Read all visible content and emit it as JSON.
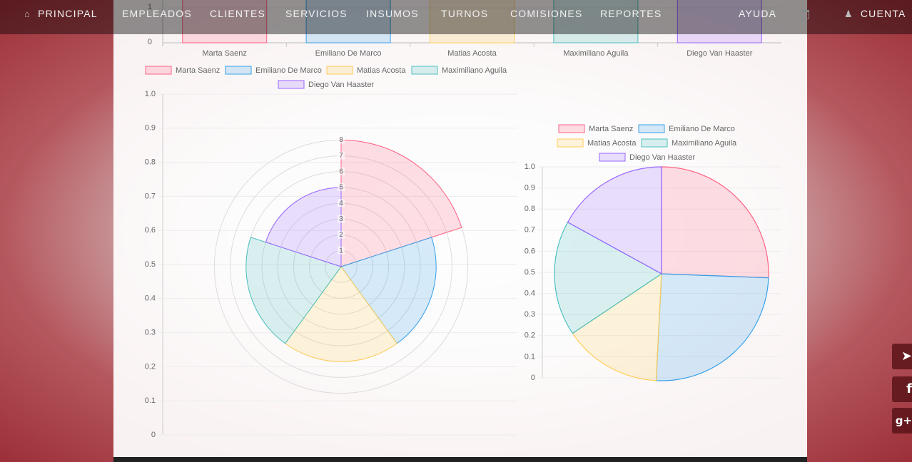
{
  "nav": {
    "items": [
      {
        "label": "PRINCIPAL",
        "icon": "home-icon"
      },
      {
        "label": "EMPLEADOS"
      },
      {
        "label": "CLIENTES"
      },
      {
        "label": "SERVICIOS"
      },
      {
        "label": "INSUMOS"
      },
      {
        "label": "TURNOS"
      },
      {
        "label": "COMISIONES"
      },
      {
        "label": "REPORTES"
      },
      {
        "label": "AYUDA"
      },
      {
        "label": "",
        "icon": "calendar-icon"
      },
      {
        "label": "CUENTA",
        "icon": "user-icon"
      }
    ]
  },
  "social": [
    {
      "label": "",
      "icon": "twitter-icon"
    },
    {
      "label": "f",
      "icon": "facebook-icon"
    },
    {
      "label": "g+",
      "icon": "google-plus-icon"
    }
  ],
  "chart_data": [
    {
      "type": "bar",
      "categories": [
        "Marta Saenz",
        "Emiliano De Marco",
        "Matias Acosta",
        "Maximiliano Aguila",
        "Diego Van Haaster"
      ],
      "visible_y_ticks": [
        0,
        1
      ],
      "values": [
        8,
        6,
        4,
        4,
        5
      ],
      "colors": [
        "#ff6384",
        "#36a2eb",
        "#ffce56",
        "#4bc0c0",
        "#9966ff"
      ],
      "fills": [
        "rgba(255,99,132,0.2)",
        "rgba(54,162,235,0.2)",
        "rgba(255,206,86,0.2)",
        "rgba(75,192,192,0.2)",
        "rgba(153,102,255,0.2)"
      ],
      "legend": [
        "Marta Saenz",
        "Emiliano De Marco",
        "Matias Acosta",
        "Maximiliano Aguila",
        "Diego Van Haaster"
      ],
      "legend_position": "bottom"
    },
    {
      "type": "polarArea",
      "labels": [
        "Marta Saenz",
        "Emiliano De Marco",
        "Matias Acosta",
        "Maximiliano Aguila",
        "Diego Van Haaster"
      ],
      "values": [
        8,
        6,
        6,
        6,
        5
      ],
      "r_ticks": [
        "1",
        "2",
        "3",
        "4",
        "5",
        "6",
        "7",
        "8"
      ],
      "r_max": 8,
      "background_axis_ticks": [
        "0",
        "0.1",
        "0.2",
        "0.3",
        "0.4",
        "0.5",
        "0.6",
        "0.7",
        "0.8",
        "0.9",
        "1.0"
      ],
      "grid": true,
      "legend_position": "top"
    },
    {
      "type": "pie",
      "labels": [
        "Marta Saenz",
        "Emiliano De Marco",
        "Matias Acosta",
        "Maximiliano Aguila",
        "Diego Van Haaster"
      ],
      "values": [
        25.6,
        25.2,
        14.8,
        17.4,
        17.0
      ],
      "background_axis_ticks": [
        "0",
        "0.1",
        "0.2",
        "0.3",
        "0.4",
        "0.5",
        "0.6",
        "0.7",
        "0.8",
        "0.9",
        "1.0"
      ],
      "grid": true,
      "legend_position": "top"
    }
  ]
}
